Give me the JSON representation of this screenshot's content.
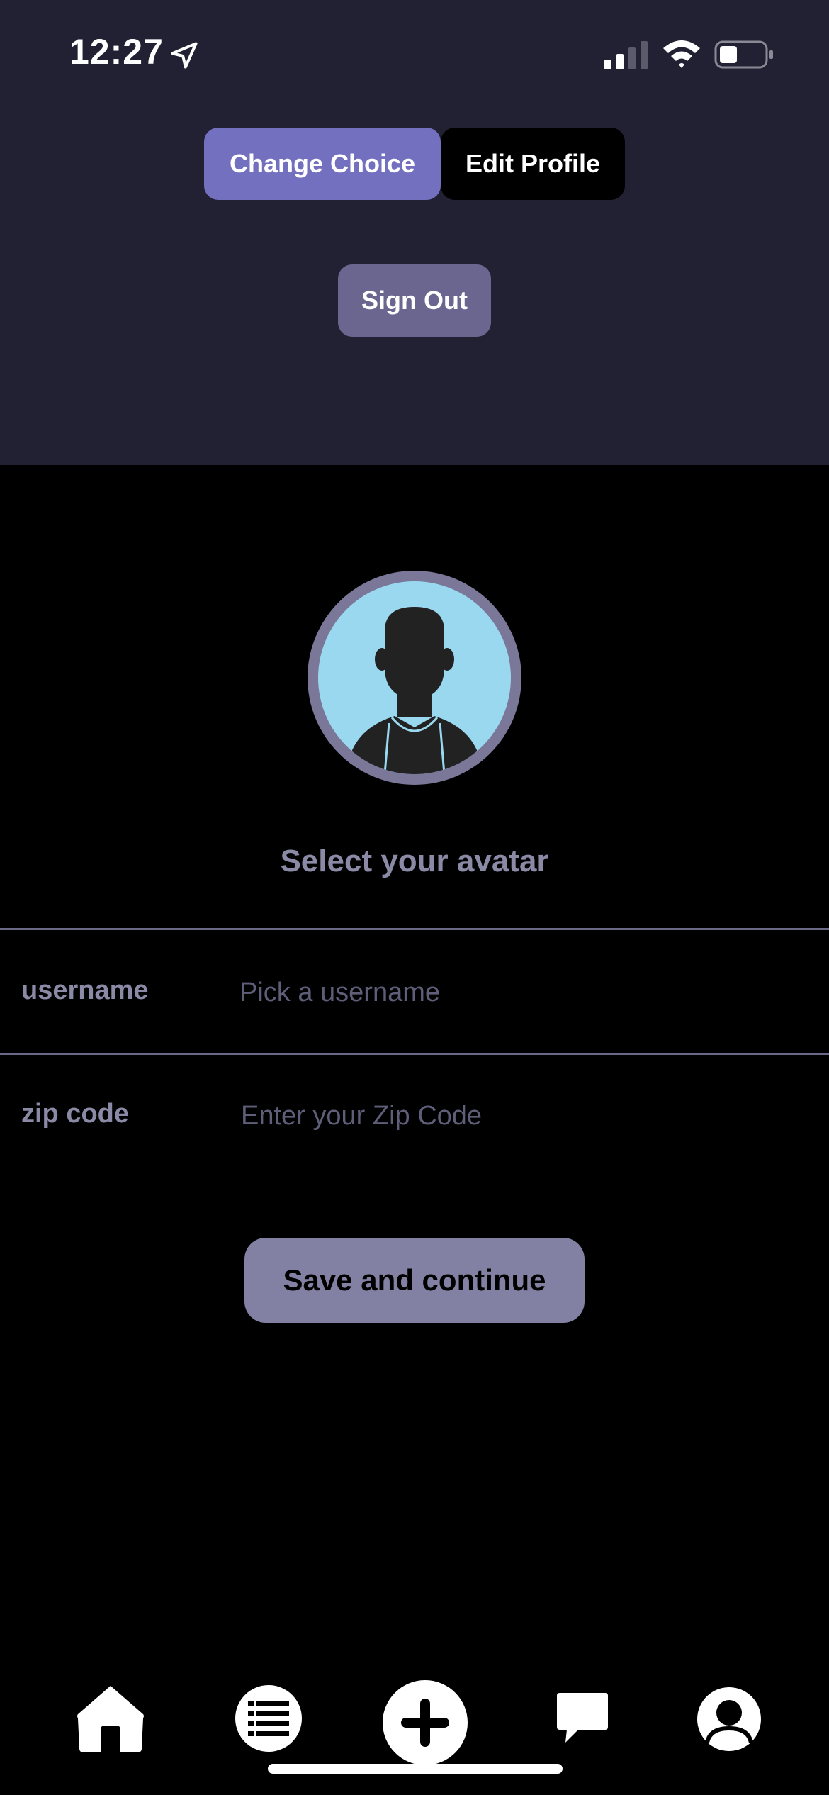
{
  "status_bar": {
    "time": "12:27",
    "icons": [
      "location-arrow-icon",
      "cellular-signal-icon",
      "wifi-icon",
      "battery-icon"
    ]
  },
  "header": {
    "change_choice_label": "Change Choice",
    "edit_profile_label": "Edit Profile",
    "sign_out_label": "Sign Out"
  },
  "avatar": {
    "caption": "Select your avatar",
    "icon": "person-silhouette-icon"
  },
  "form": {
    "username": {
      "label": "username",
      "value": "",
      "placeholder": "Pick a username"
    },
    "zip_code": {
      "label": "zip code",
      "value": "",
      "placeholder": "Enter your Zip Code"
    },
    "submit_label": "Save and continue"
  },
  "tab_bar": {
    "items": [
      "home-icon",
      "list-icon",
      "add-icon",
      "chat-icon",
      "profile-icon"
    ]
  },
  "colors": {
    "header_background": "#222133",
    "page_background": "#000000",
    "accent_primary": "#7370c0",
    "sign_out_button": "#6a6690",
    "save_button": "#8280a3",
    "muted_text": "#8a89a6",
    "avatar_background": "#9ad8f0"
  }
}
